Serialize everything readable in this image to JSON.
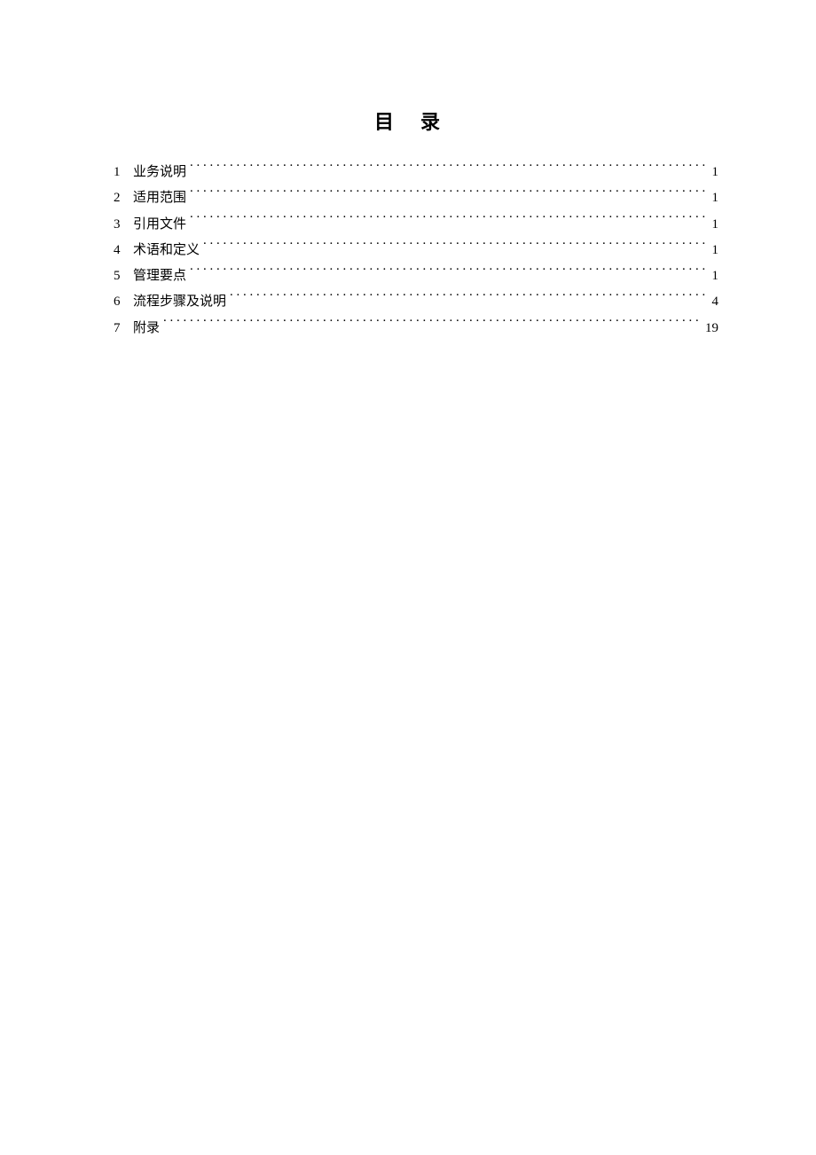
{
  "title": "目 录",
  "toc": {
    "entries": [
      {
        "num": "1",
        "label": "业务说明",
        "page": "1"
      },
      {
        "num": "2",
        "label": "适用范围",
        "page": "1"
      },
      {
        "num": "3",
        "label": "引用文件",
        "page": "1"
      },
      {
        "num": "4",
        "label": "术语和定义",
        "page": "1"
      },
      {
        "num": "5",
        "label": "管理要点",
        "page": "1"
      },
      {
        "num": "6",
        "label": "流程步骤及说明",
        "page": "4"
      },
      {
        "num": "7",
        "label": "附录",
        "page": "19"
      }
    ]
  }
}
